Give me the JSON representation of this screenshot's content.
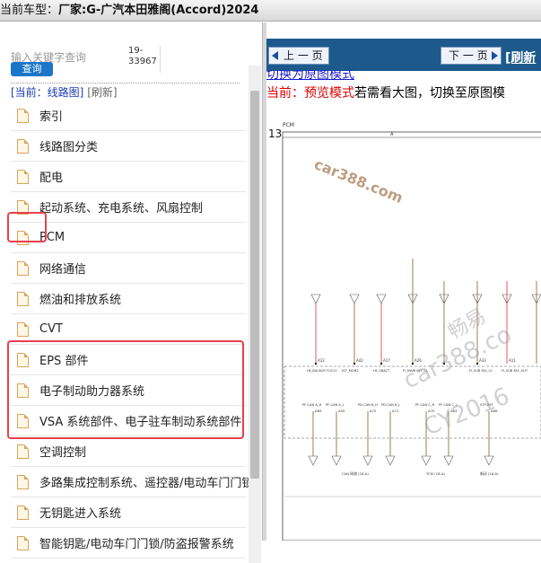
{
  "titlebar": {
    "prefix": "当前车型：",
    "car": "厂家:G-广汽本田雅阁(Accord)2024"
  },
  "search": {
    "placeholder": "输入关键字查询",
    "code": "19-33967",
    "button": "查询"
  },
  "current": {
    "label": "[当前：线路图]",
    "refresh": "[刷新]"
  },
  "sidebar": {
    "items": [
      {
        "label": "索引"
      },
      {
        "label": "线路图分类"
      },
      {
        "label": "配电"
      },
      {
        "label": "起动系统、充电系统、风扇控制"
      },
      {
        "label": "PCM"
      },
      {
        "label": "网络通信"
      },
      {
        "label": "燃油和排放系统"
      },
      {
        "label": "CVT"
      },
      {
        "label": "EPS 部件"
      },
      {
        "label": "电子制动助力器系统"
      },
      {
        "label": "VSA 系统部件、电子驻车制动系统部件"
      },
      {
        "label": "空调控制"
      },
      {
        "label": "多路集成控制系统、遥控器/电动车门门锁"
      },
      {
        "label": "无钥匙进入系统"
      },
      {
        "label": "智能钥匙/电动车门门锁/防盗报警系统"
      }
    ]
  },
  "viewer": {
    "prev": "上 一 页",
    "next": "下 一 页",
    "refresh": "[刷新",
    "switch": "切换为原图模式",
    "mode_prefix": "当前：",
    "mode_name": "预览模式",
    "mode_tail": "若需看大图，切换至原图模",
    "diagram": {
      "title": "PCM",
      "page_no": "13",
      "col_a": "A",
      "watermark": "car388.com",
      "watermark2": "畅易",
      "watermark3": "car388.co",
      "watermark4": "CY2016",
      "pins_top": [
        "A12",
        "A42",
        "A17",
        "A26",
        "A33",
        "A11"
      ],
      "labels_top": [
        "+B_BACKUP FI-ECU",
        "IGT_MON2",
        "+B_VBACT",
        "FI_MAIN RLY_CL",
        "FI_SUB RLY_CL",
        "FI_SUB RLY_OUT"
      ],
      "labels_bottom": [
        "PF-CAN A_H",
        "PF-CAN A_L",
        "PD-CAN B_H",
        "PD-CAN B_L",
        "PF-CAN C_H",
        "PF-CAN C_L",
        "STP-REF"
      ],
      "pins_bottom": [
        "A69",
        "A55",
        "A72",
        "A71",
        "A70",
        "A63",
        "A66"
      ],
      "bottom_notes": [
        "CAN 网络 (18-A)",
        "TCM (18-A)",
        "制动 (18-A)"
      ]
    }
  },
  "colors": {
    "topbar": "#1d5a8b",
    "highlight": "#e8414e",
    "button": "#1a76c9",
    "mode_red": "#e00000"
  }
}
